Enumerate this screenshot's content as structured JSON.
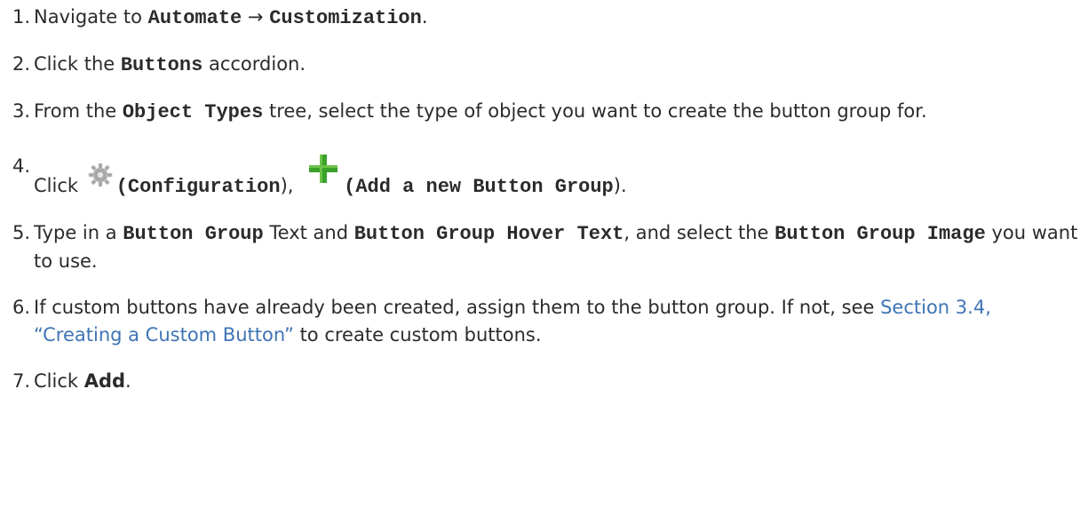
{
  "steps": [
    {
      "number": "1.",
      "parts": [
        "Navigate to ",
        "Automate",
        " → ",
        "Customization",
        "."
      ]
    },
    {
      "number": "2.",
      "parts": [
        "Click the ",
        "Buttons",
        " accordion."
      ]
    },
    {
      "number": "3.",
      "parts": [
        "From the ",
        "Object Types",
        " tree, select the type of object you want to create the button group for."
      ]
    },
    {
      "number": "4.",
      "parts": [
        "Click ",
        "(",
        "Configuration",
        "), ",
        "(",
        "Add a new Button Group",
        ")."
      ]
    },
    {
      "number": "5.",
      "parts": [
        "Type in a ",
        "Button Group",
        " Text and ",
        "Button Group Hover Text",
        ", and select the ",
        "Button Group Image",
        " you want to use."
      ]
    },
    {
      "number": "6.",
      "parts": [
        "If custom buttons have already been created, assign them to the button group. If not, see ",
        "Section 3.4, “Creating a Custom Button”",
        " to create custom buttons."
      ]
    },
    {
      "number": "7.",
      "parts": [
        "Click ",
        "Add",
        "."
      ]
    }
  ],
  "icons": {
    "configuration": "gear-icon",
    "add": "plus-icon"
  },
  "colors": {
    "text": "#2b2b2b",
    "link": "#3e74b4",
    "plus_green": "#3aa12a",
    "gear_gray": "#a8a8a8"
  }
}
